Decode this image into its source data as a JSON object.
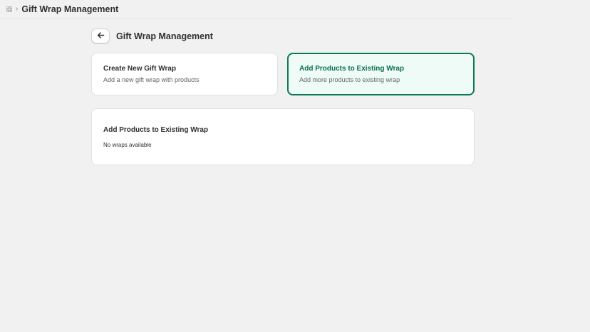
{
  "topbar": {
    "app_icon": "grid-icon",
    "separator_icon": "chevron-right-icon",
    "title": "Gift Wrap Management"
  },
  "header": {
    "back_icon": "arrow-left-icon",
    "title": "Gift Wrap Management"
  },
  "options": [
    {
      "title": "Create New Gift Wrap",
      "subtitle": "Add a new gift wrap with products",
      "selected": false
    },
    {
      "title": "Add Products to Existing Wrap",
      "subtitle": "Add more products to existing wrap",
      "selected": true
    }
  ],
  "panel": {
    "title": "Add Products to Existing Wrap",
    "empty_message": "No wraps available"
  },
  "colors": {
    "accent": "#0b7a5a",
    "selected_bg": "#effbf6",
    "page_bg": "#f1f1f1"
  }
}
